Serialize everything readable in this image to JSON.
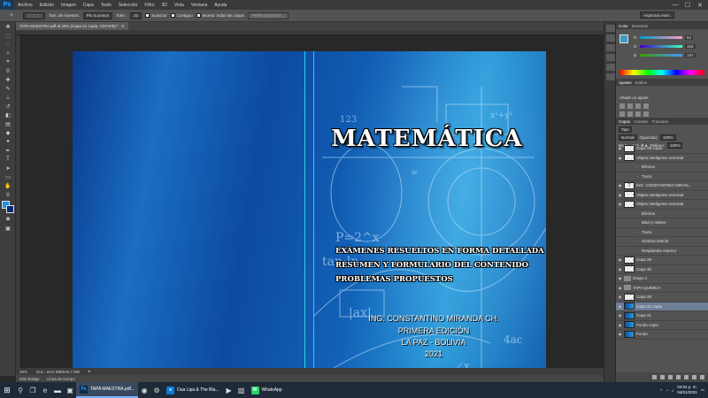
{
  "app": {
    "logo": "Ps"
  },
  "menu": [
    "Archivo",
    "Edición",
    "Imagen",
    "Capa",
    "Texto",
    "Selección",
    "Filtro",
    "3D",
    "Vista",
    "Ventana",
    "Ayuda"
  ],
  "window_controls": {
    "minimize": "—",
    "maximize": "☐",
    "close": "✕"
  },
  "options": {
    "sample_label": "Tam. de muestra:",
    "sample_value": "Pto 5 puntos",
    "tolerance_label": "Toler.:",
    "tolerance_value": "32",
    "antialias_label": "Suavizar",
    "contiguous_label": "Contiguo",
    "all_layers_label": "Muestr. todas las capas",
    "refine_button": "Perfeccionar bor...",
    "workspace": "Aspectos esen."
  },
  "document": {
    "tab_title": "TAPA MAESTRA.pdf al 29% (Capa 21 copia, CMYK/8) *",
    "title": "MATEMÁTICA",
    "subtitle_lines": [
      "EXÁMENES RESUELTOS EN FORMA DETALLADA",
      "RESUMEN Y FORMULARIO DEL CONTENIDO",
      "PROBLEMAS PROPUESTOS"
    ],
    "author": "ING. CONSTANTINO MIRANDA CH.",
    "edition": "PRIMERA EDICIÓN",
    "city": "LA PAZ - BOLIVIA",
    "year": "2021"
  },
  "status": {
    "zoom": "29%",
    "doc_info": "Doc.: 64,6 MB/529,7 MB"
  },
  "timeline_tabs": [
    "Mini Bridge",
    "Línea de tiempo"
  ],
  "color_panel": {
    "tabs": [
      "Color",
      "Muestras"
    ],
    "sliders": [
      {
        "label": "R",
        "value": "64"
      },
      {
        "label": "G",
        "value": "153"
      },
      {
        "label": "B",
        "value": "197"
      }
    ]
  },
  "adjust_panel": {
    "tabs": [
      "Ajustes",
      "Estilos"
    ],
    "label": "Añadir un ajuste"
  },
  "layers_panel": {
    "tabs": [
      "Capas",
      "Canales",
      "Trazados"
    ],
    "filter": "Tipo",
    "blend_mode": "Normal",
    "opacity_label": "Opacidad:",
    "opacity_value": "100%",
    "lock_label": "Bloq.:",
    "fill_label": "Relleno:",
    "fill_value": "100%",
    "layers": [
      {
        "name": "Capa 28 copia",
        "thumb": "checker",
        "sub": false,
        "selected": false
      },
      {
        "name": "Objeto inteligente vectorial",
        "thumb": "checker",
        "sub": false,
        "selected": false
      },
      {
        "name": "Efectos",
        "thumb": "",
        "sub": true,
        "selected": false
      },
      {
        "name": "Trazo",
        "thumb": "",
        "sub": true,
        "selected": false
      },
      {
        "name": "ING. CONSTANTINO MIRAN...",
        "thumb": "text",
        "sub": false,
        "selected": false
      },
      {
        "name": "Objeto inteligente vectorial",
        "thumb": "checker",
        "sub": false,
        "selected": false
      },
      {
        "name": "Objeto inteligente vectorial",
        "thumb": "checker",
        "sub": false,
        "selected": false
      },
      {
        "name": "Efectos",
        "thumb": "",
        "sub": true,
        "selected": false
      },
      {
        "name": "Bisel y relieve",
        "thumb": "",
        "sub": true,
        "selected": false
      },
      {
        "name": "Trazo",
        "thumb": "",
        "sub": true,
        "selected": false
      },
      {
        "name": "Sombra interior",
        "thumb": "",
        "sub": true,
        "selected": false
      },
      {
        "name": "Resplandor exterior",
        "thumb": "",
        "sub": true,
        "selected": false
      },
      {
        "name": "Capa 29",
        "thumb": "checker",
        "sub": false,
        "selected": false
      },
      {
        "name": "Capa 30",
        "thumb": "checker",
        "sub": false,
        "selected": false
      },
      {
        "name": "Grupo 1",
        "thumb": "folder",
        "sub": false,
        "selected": false
      },
      {
        "name": "TAPA QUIMICA",
        "thumb": "folder",
        "sub": false,
        "selected": false
      },
      {
        "name": "Capa 28",
        "thumb": "checker",
        "sub": false,
        "selected": false
      },
      {
        "name": "Capa 21 copia",
        "thumb": "blue",
        "sub": false,
        "selected": true
      },
      {
        "name": "Capa 21",
        "thumb": "blue",
        "sub": false,
        "selected": false
      },
      {
        "name": "Fondo copia",
        "thumb": "blue",
        "sub": false,
        "selected": false
      },
      {
        "name": "Fondo",
        "thumb": "blue",
        "sub": false,
        "selected": false
      }
    ]
  },
  "taskbar": {
    "apps": [
      {
        "name": "TAPA MAESTRA.pdf...",
        "badge": "Ps",
        "active": true
      },
      {
        "name": "Dua Lipa & The Bla...",
        "badge": "e",
        "active": false
      },
      {
        "name": "WhatsApp",
        "badge": "W",
        "active": false
      }
    ],
    "time": "04:04 p. m.",
    "date": "04/01/2021"
  },
  "colors": {
    "accent": "#31a8ff",
    "cover_blue": "#1262b8",
    "guide": "#2ad4e8"
  }
}
